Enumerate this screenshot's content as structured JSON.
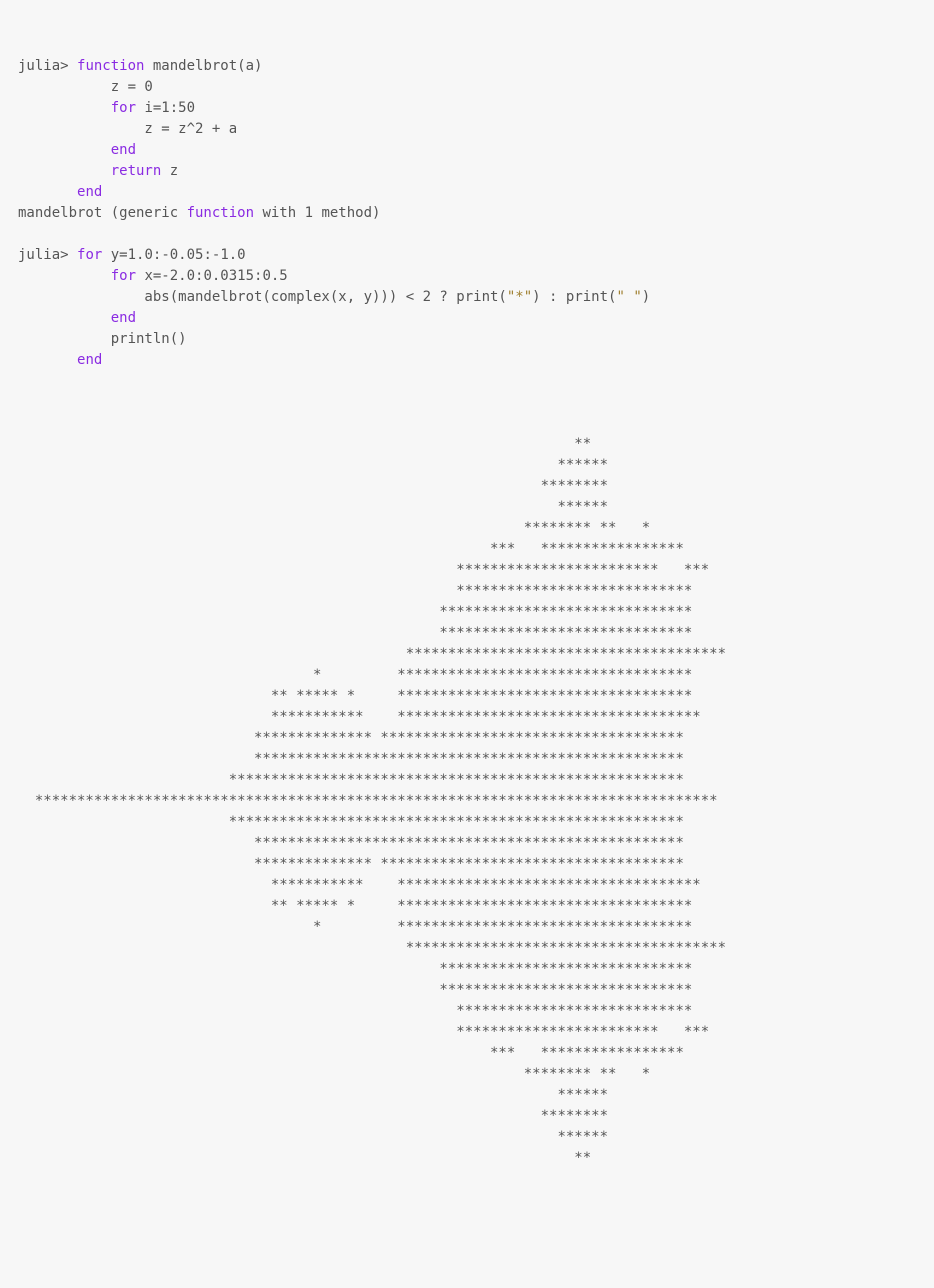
{
  "code": {
    "prompt": "julia>",
    "kw_function": "function",
    "fn_name": " mandelbrot(a)",
    "line_z0": "           z = 0",
    "kw_for1": "for",
    "for1_rest": " i=1:50",
    "line_zupd": "               z = z^2 + a",
    "kw_end1": "end",
    "kw_return": "return",
    "ret_rest": " z",
    "kw_end2": "end",
    "def_line_a": "mandelbrot (generic ",
    "kw_function2": "function",
    "def_line_b": " with 1 method)",
    "kw_for2": "for",
    "for2_rest": " y=1.0:-0.05:-1.0",
    "kw_for3": "for",
    "for3_rest": " x=-2.0:0.0315:0.5",
    "abs_a": "               abs(mandelbrot(complex(x, y))) < 2 ? print(",
    "str1": "\"*\"",
    "abs_b": ") : print(",
    "str2": "\" \"",
    "abs_c": ")",
    "kw_end3": "end",
    "println": "           println()",
    "kw_end4": "end"
  },
  "output": [
    "                                                                                ",
    "                                                                                ",
    "                                                                                ",
    "                                                                  **            ",
    "                                                                ******          ",
    "                                                              ********          ",
    "                                                                ******          ",
    "                                                            ******** **   *     ",
    "                                                        ***   *****************     ",
    "                                                    ************************   ***  ",
    "                                                    ****************************    ",
    "                                                  ******************************    ",
    "                                                  ******************************    ",
    "                                              **************************************",
    "                                   *         ***********************************    ",
    "                              ** ***** *     ***********************************    ",
    "                              ***********    ************************************   ",
    "                            ************** ************************************     ",
    "                            ***************************************************     ",
    "                         ******************************************************     ",
    "  ********************************************************************************* ",
    "                         ******************************************************     ",
    "                            ***************************************************     ",
    "                            ************** ************************************     ",
    "                              ***********    ************************************   ",
    "                              ** ***** *     ***********************************    ",
    "                                   *         ***********************************    ",
    "                                              **************************************",
    "                                                  ******************************    ",
    "                                                  ******************************    ",
    "                                                    ****************************    ",
    "                                                    ************************   ***  ",
    "                                                        ***   *****************     ",
    "                                                            ******** **   *     ",
    "                                                                ******          ",
    "                                                              ********          ",
    "                                                                ******          ",
    "                                                                  **            ",
    "                                                                                ",
    "                                                                                "
  ]
}
